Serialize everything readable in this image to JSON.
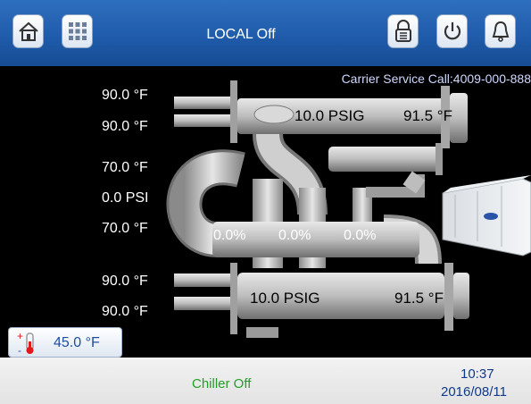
{
  "header": {
    "title": "LOCAL Off",
    "icons": [
      "home-icon",
      "grid-icon",
      "lock-icon",
      "power-icon",
      "bell-icon"
    ]
  },
  "service": {
    "text": "Carrier Service Call:4009-000-888"
  },
  "left_labels": {
    "cond_in": "90.0 °F",
    "cond_out": "90.0 °F",
    "evap_leave": "70.0 °F",
    "pressure": "0.0 PSI",
    "evap_enter": "70.0 °F",
    "evap_in": "90.0 °F",
    "evap_out": "90.0 °F"
  },
  "condenser": {
    "pressure": "10.0 PSIG",
    "temp": "91.5 °F"
  },
  "evaporator": {
    "pressure": "10.0 PSIG",
    "temp": "91.5 °F"
  },
  "percentages": [
    "0.0%",
    "0.0%",
    "0.0%"
  ],
  "setpoint": {
    "value": "45.0 °F",
    "icon": "thermometer-icon"
  },
  "footer": {
    "status": "Chiller Off",
    "time": "10:37",
    "date": "2016/08/11"
  },
  "colors": {
    "header": "#1e5aa8",
    "status": "#22a025",
    "datetime": "#113a8a"
  }
}
